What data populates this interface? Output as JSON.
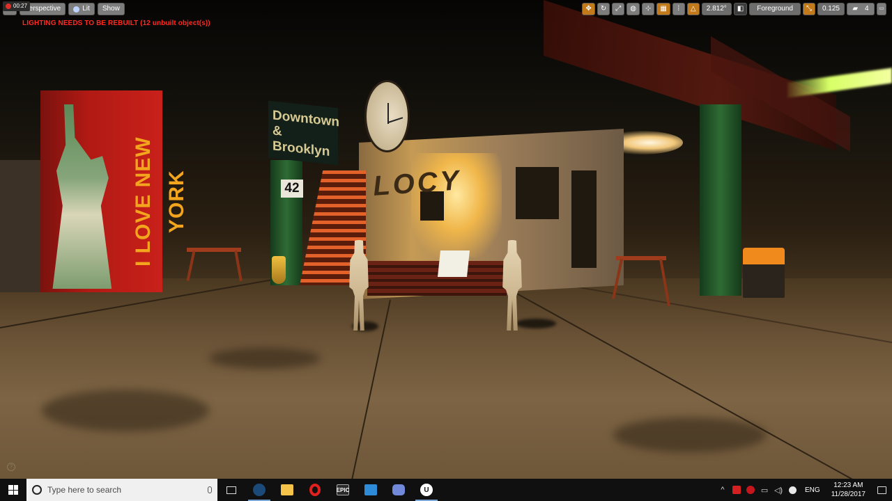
{
  "recorder": {
    "time": "00:27"
  },
  "viewport_toolbar": {
    "perspective_label": "Perspective",
    "lit_label": "Lit",
    "show_label": "Show"
  },
  "warnings": {
    "lighting": "LIGHTING NEEDS TO BE REBUILT (12 unbuilt object(s))"
  },
  "viewport_toolbar_right": {
    "rotation_snap_value": "2.812°",
    "camera_speed_label": "Foreground",
    "scale_snap_value": "0.125",
    "camera_speed_value": "4"
  },
  "scene": {
    "sign_text": "Downtown & Brooklyn",
    "sign_number": "42",
    "poster_text": "I LOVE NEW YORK",
    "graffiti_text": "LOCY"
  },
  "taskbar": {
    "search_placeholder": "Type here to search",
    "language": "ENG",
    "time": "12:23 AM",
    "date": "11/28/2017",
    "apps": [
      {
        "name": "task-view",
        "label": ""
      },
      {
        "name": "steam",
        "label": ""
      },
      {
        "name": "file-explorer",
        "label": ""
      },
      {
        "name": "opera",
        "label": ""
      },
      {
        "name": "epic-games",
        "label": "EPIC"
      },
      {
        "name": "store",
        "label": ""
      },
      {
        "name": "discord",
        "label": ""
      },
      {
        "name": "unreal-engine",
        "label": "U"
      }
    ]
  },
  "colors": {
    "warning_red": "#ff2a22",
    "toolbar_gray": "#7d7d7d",
    "accent_orange": "#c37a1a",
    "taskbar_bg": "#101010"
  }
}
